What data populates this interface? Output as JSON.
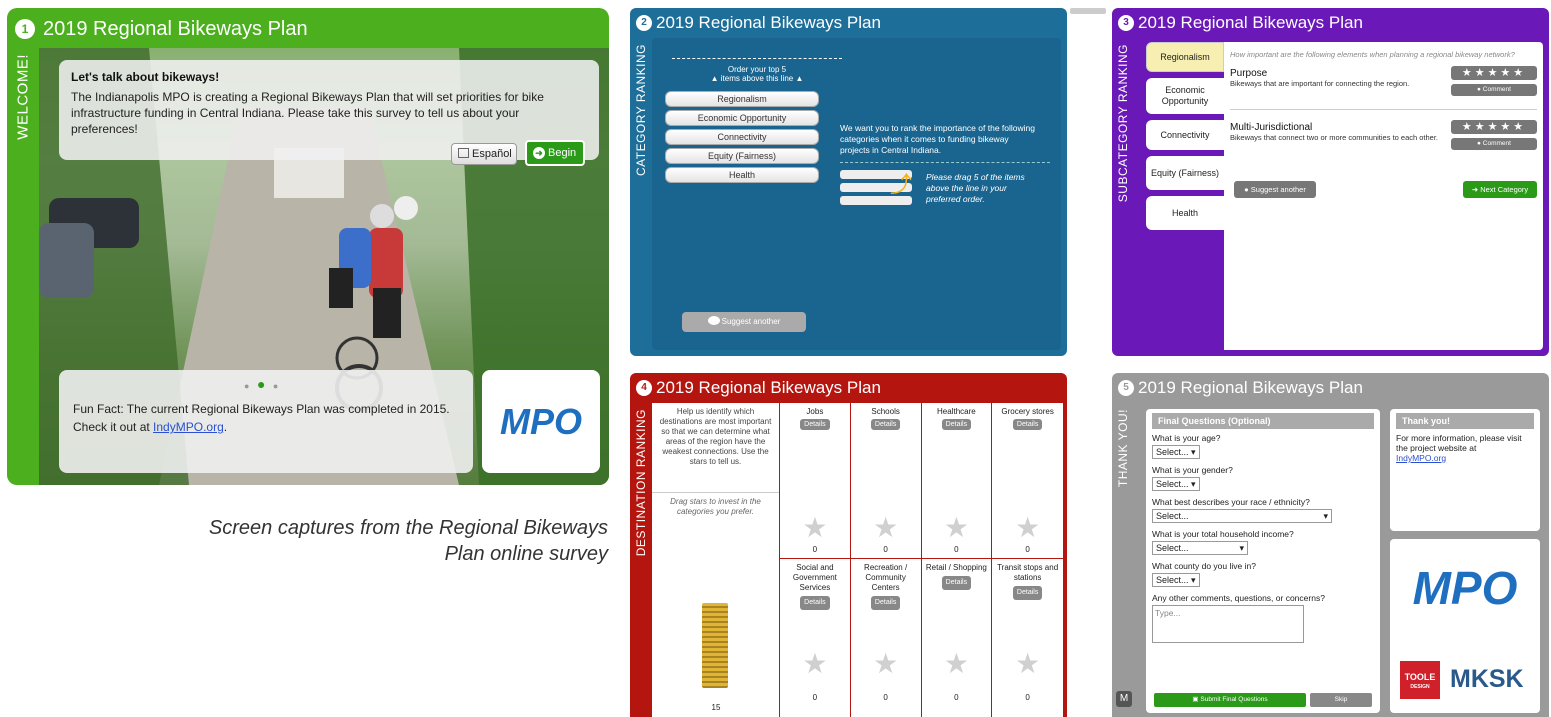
{
  "caption": {
    "line1": "Screen captures from the Regional Bikeways",
    "line2": "Plan online survey"
  },
  "p1": {
    "num": "1",
    "title": "2019 Regional Bikeways Plan",
    "tab": "WELCOME!",
    "heading": "Let's talk about bikeways!",
    "body": "The Indianapolis MPO is creating a Regional Bikeways Plan that will set priorities for bike infrastructure funding in Central Indiana. Please take this survey to tell us about your preferences!",
    "espanol": "Español",
    "begin": "Begin",
    "fact": "Fun Fact: The current Regional Bikeways Plan was completed in 2015. Check it out at ",
    "fact_link": "IndyMPO.org",
    "fact_end": ".",
    "logo": "MPO",
    "colors": {
      "bar": "#4caf1e",
      "accent": "#2a8a1a"
    }
  },
  "p2": {
    "num": "2",
    "title": "2019 Regional Bikeways Plan",
    "tab": "CATEGORY RANKING",
    "order_text": "Order your top 5",
    "order_text2": "items above this line",
    "items": [
      "Regionalism",
      "Economic Opportunity",
      "Connectivity",
      "Equity (Fairness)",
      "Health"
    ],
    "instructions": "We want you to rank the importance of the following categories when it comes to funding bikeway projects in Central Indiana.",
    "drag_hint": "Please drag 5 of the items above the line in your preferred order.",
    "suggest": "Suggest another",
    "color": "#1d6e99"
  },
  "p3": {
    "num": "3",
    "title": "2019 Regional Bikeways Plan",
    "tab": "SUBCATEGORY RANKING",
    "tabs": [
      "Regionalism",
      "Economic Opportunity",
      "Connectivity",
      "Equity (Fairness)",
      "Health"
    ],
    "question": "How important are the following elements when planning a regional bikeway network?",
    "items": [
      {
        "title": "Purpose",
        "desc": "Bikeways that are important for connecting the region.",
        "comment": "Comment"
      },
      {
        "title": "Multi-Jurisdictional",
        "desc": "Bikeways that connect two or more communities to each other.",
        "comment": "Comment"
      }
    ],
    "suggest": "Suggest another",
    "next": "Next Category",
    "color": "#6a18b8"
  },
  "p4": {
    "num": "4",
    "title": "2019 Regional Bikeways Plan",
    "tab": "DESTINATION RANKING",
    "help": "Help us identify which destinations are most important so that we can determine what areas of the region have the weakest connections. Use the stars to tell us.",
    "drag": "Drag stars to invest in the categories you prefer.",
    "stack_count": "15",
    "cells": [
      {
        "label": "Jobs",
        "details": "Details",
        "count": "0"
      },
      {
        "label": "Schools",
        "details": "Details",
        "count": "0"
      },
      {
        "label": "Healthcare",
        "details": "Details",
        "count": "0"
      },
      {
        "label": "Grocery stores",
        "details": "Details",
        "count": "0"
      },
      {
        "label": "Social and Government Services",
        "details": "Details",
        "count": "0"
      },
      {
        "label": "Recreation / Community Centers",
        "details": "Details",
        "count": "0"
      },
      {
        "label": "Retail / Shopping",
        "details": "Details",
        "count": "0"
      },
      {
        "label": "Transit stops and stations",
        "details": "Details",
        "count": "0"
      }
    ],
    "color": "#b4150f"
  },
  "p5": {
    "num": "5",
    "title": "2019 Regional Bikeways Plan",
    "tab": "THANK YOU!",
    "form_title": "Final Questions (Optional)",
    "q_age": "What is your age?",
    "q_gender": "What is your gender?",
    "q_race": "What best describes your race / ethnicity?",
    "q_income": "What is your total household income?",
    "q_county": "What county do you live in?",
    "q_comments": "Any other comments, questions, or concerns?",
    "select": "Select...",
    "type_ph": "Type...",
    "submit": "Submit Final Questions",
    "skip": "Skip",
    "thanks_title": "Thank you!",
    "thanks_body": "For more information, please visit the project website at",
    "thanks_link": "IndyMPO.org",
    "logo_mpo": "MPO",
    "logo_toole": "TOOLE",
    "logo_toole2": "DESIGN",
    "logo_mksk": "MKSK",
    "color": "#9a9a9a"
  }
}
